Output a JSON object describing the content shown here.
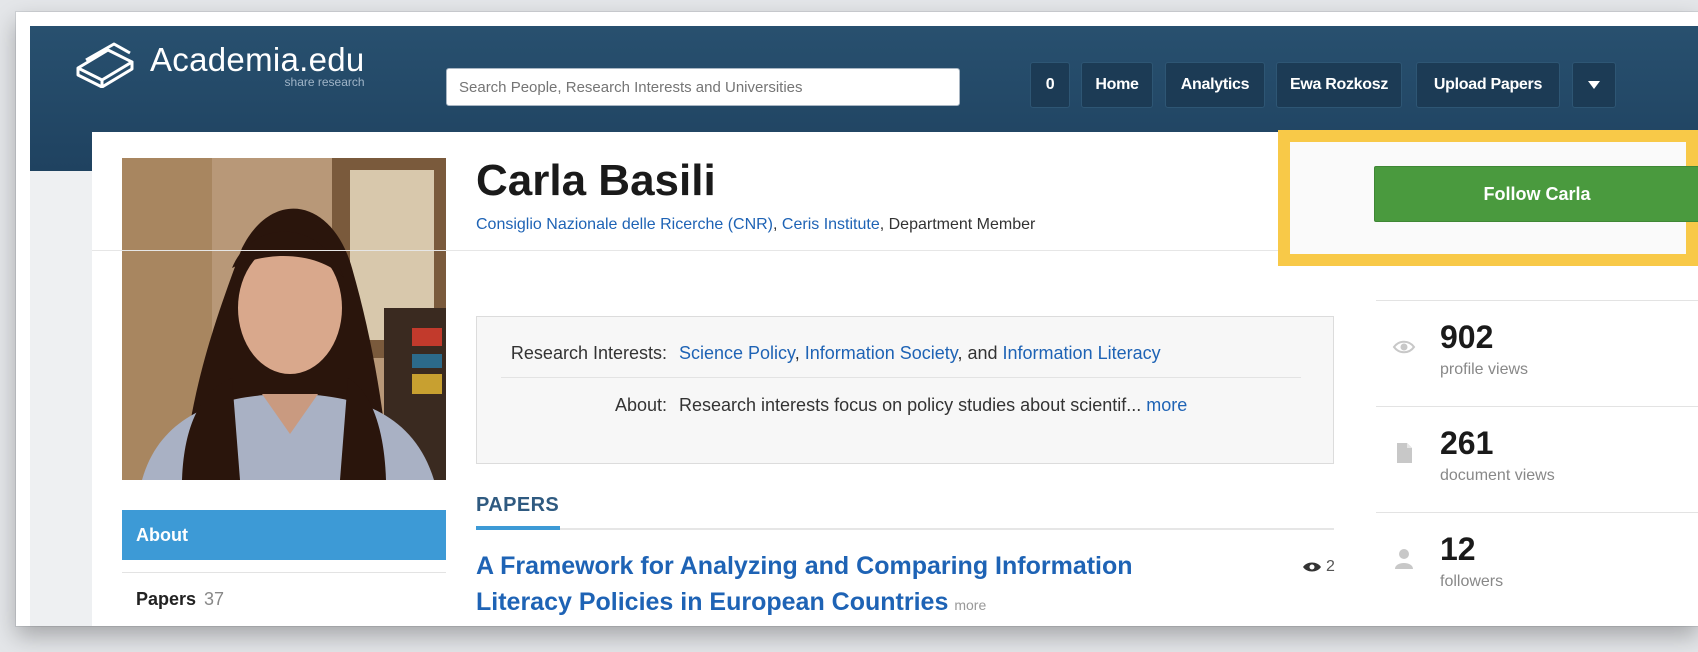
{
  "header": {
    "logo_name": "Academia.edu",
    "logo_tagline": "share research",
    "search_placeholder": "Search People, Research Interests and Universities",
    "nav": [
      {
        "label": "0"
      },
      {
        "label": "Home"
      },
      {
        "label": "Analytics"
      },
      {
        "label": "Ewa Rozkosz"
      },
      {
        "label": "Upload Papers"
      }
    ]
  },
  "profile": {
    "name": "Carla Basili",
    "affiliation_institution": "Consiglio Nazionale delle Ricerche (CNR)",
    "affiliation_sep": ", ",
    "affiliation_unit": "Ceris Institute",
    "affiliation_role": ", Department Member",
    "follow_label": "Follow Carla"
  },
  "info": {
    "research_label": "Research Interests:",
    "interests": [
      "Science Policy",
      "Information Society",
      "Information Literacy"
    ],
    "sep1": ", ",
    "sep2": ", and ",
    "about_label": "About:",
    "about_text": "Research interests focus on policy studies about scientif...",
    "about_more": "more"
  },
  "sidebar": {
    "tabs": [
      {
        "label": "About"
      },
      {
        "label": "Papers",
        "count": "37"
      }
    ]
  },
  "papers": {
    "heading": "PAPERS",
    "items": [
      {
        "title": "A Framework for Analyzing and Comparing Information Literacy Policies in European Countries",
        "more": "more",
        "views": "2"
      }
    ]
  },
  "stats": [
    {
      "value": "902",
      "label": "profile views",
      "icon": "eye-icon"
    },
    {
      "value": "261",
      "label": "document views",
      "icon": "document-icon"
    },
    {
      "value": "12",
      "label": "followers",
      "icon": "person-icon"
    }
  ],
  "colors": {
    "header_bg": "#28506f",
    "link": "#1e63b5",
    "about_tab": "#3d9ad6",
    "follow_button": "#4a9a3e",
    "highlight": "#f8c948"
  }
}
